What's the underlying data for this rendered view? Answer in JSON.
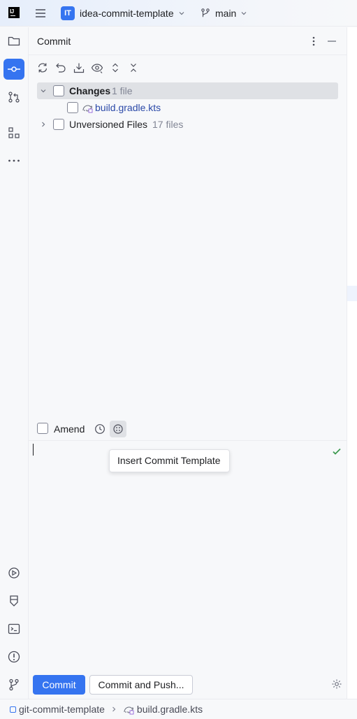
{
  "titlebar": {
    "project_badge": "IT",
    "project_name": "idea-commit-template",
    "branch_name": "main"
  },
  "commit_panel": {
    "title": "Commit",
    "tree": {
      "changes_label": "Changes",
      "changes_count": "1 file",
      "changed_file": "build.gradle.kts",
      "unversioned_label": "Unversioned Files",
      "unversioned_count": "17 files"
    },
    "amend_label": "Amend",
    "tooltip": "Insert Commit Template",
    "commit_button": "Commit",
    "commit_push_button": "Commit and Push..."
  },
  "statusbar": {
    "project": "git-commit-template",
    "file": "build.gradle.kts"
  },
  "colors": {
    "accent": "#3574f0",
    "file_modified": "#2b49a8",
    "check": "#3d9a50"
  },
  "icons": [
    "hamburger-icon",
    "folder-icon",
    "commit-icon",
    "pull-requests-icon",
    "structure-icon",
    "more-icon",
    "services-icon",
    "build-icon",
    "terminal-icon",
    "problems-icon",
    "git-icon",
    "refresh-icon",
    "rollback-icon",
    "update-icon",
    "eye-icon",
    "expand-icon",
    "collapse-icon",
    "history-icon",
    "template-icon",
    "check-icon",
    "gear-icon",
    "gradle-icon"
  ]
}
